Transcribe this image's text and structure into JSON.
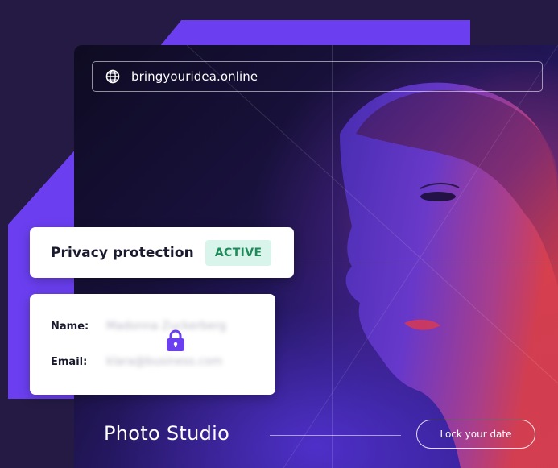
{
  "browser": {
    "url": "bringyouridea.online",
    "page_title": "Photo Studio",
    "cta_label": "Lock your date"
  },
  "privacy": {
    "title": "Privacy protection",
    "status": "ACTIVE",
    "status_color": "#1f8a5b",
    "status_bg": "#d9f4ea"
  },
  "details": {
    "name_label": "Name:",
    "name_value": "Madonna Zuckerberg",
    "email_label": "Email:",
    "email_value": "klara@business.com",
    "lock_icon": "lock-icon"
  },
  "colors": {
    "accent": "#6b3ff0",
    "background": "#241a44"
  }
}
